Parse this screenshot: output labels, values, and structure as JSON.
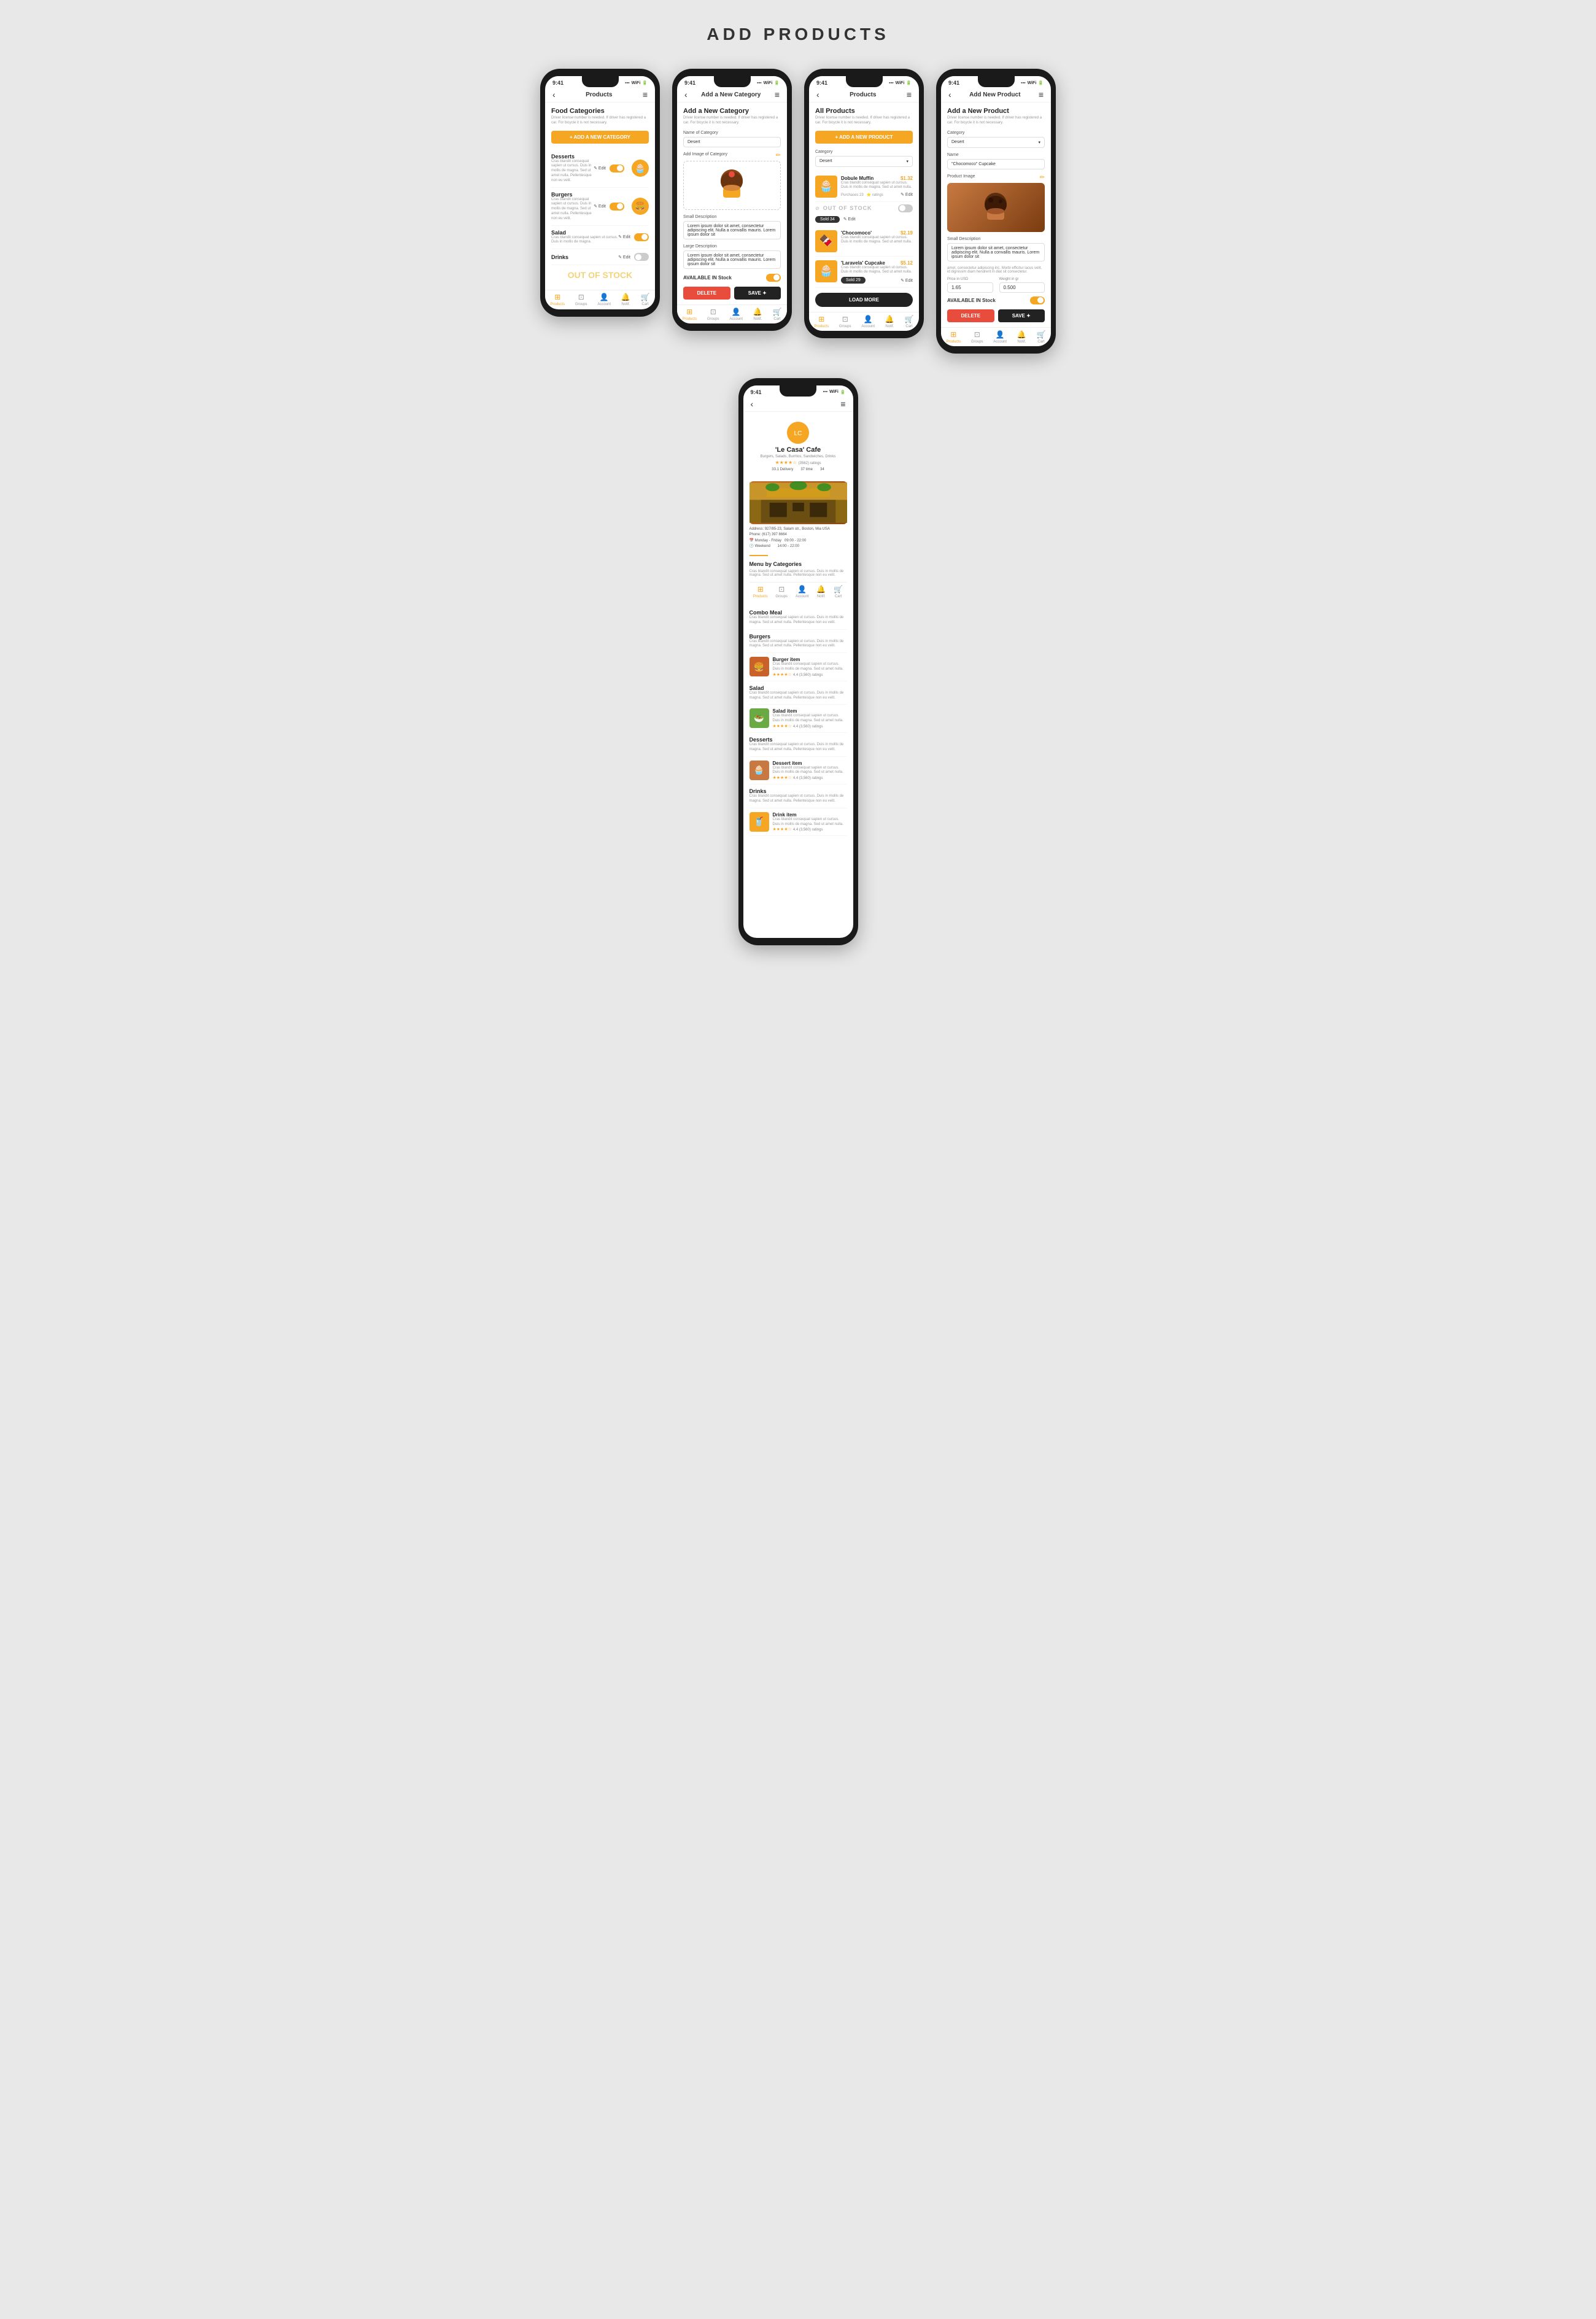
{
  "page": {
    "title": "ADD PRODUCTS"
  },
  "phone1": {
    "status_time": "9:41",
    "title": "Products",
    "screen_title": "Food Categories",
    "subtitle": "Driver license number is needed. If driver has registered a car. For bicycle it is not necessary.",
    "add_btn": "+ ADD A NEW CATEGORY",
    "categories": [
      {
        "name": "Desserts",
        "desc": "Cras blandit consequat sapien ut cursus. Duis in mollis de magna. Sed ut amet nulla. Pellentesque non eu velit.",
        "has_img": true,
        "on": true
      },
      {
        "name": "Burgers",
        "desc": "Cras blandit consequat sapien ut cursus. Duis in mollis de magna. Sed ut amet nulla. Pellentesque non eu velit.",
        "has_img": true,
        "on": true
      },
      {
        "name": "Salad",
        "desc": "Cras blandit consequat sapien ut cursus. Duis in mollis de magna.",
        "has_img": false,
        "on": true
      },
      {
        "name": "Drinks",
        "desc": "",
        "has_img": false,
        "on": false
      }
    ],
    "out_of_stock": "OUT OF STOCK",
    "bottom_nav": [
      "Products",
      "Groups",
      "Account",
      "Notifications",
      "Cart"
    ]
  },
  "phone2": {
    "status_time": "9:41",
    "title": "Add a New Category",
    "screen_title": "Add a New Category",
    "subtitle": "Driver license number is needed. If driver has registered a car. For bicycle it is not necessary.",
    "form": {
      "name_label": "Name of Category",
      "name_value": "Desert",
      "image_label": "Add Image of Category",
      "small_desc_label": "Small Description",
      "small_desc_value": "Lorem ipsum dolor sit amet, consectetur adipiscing elit. Nulla a convallis mauris. Lorem ipsum dolor sit",
      "large_desc_label": "Large Description",
      "large_desc_value": "Lorem ipsum dolor sit amet, consectetur adipiscing elit. Nulla a convallis mauris. Lorem ipsum dolor sit"
    },
    "available_stock": "AVAILABLE IN Stock",
    "delete_btn": "DELETE",
    "save_btn": "SAVE ✦",
    "bottom_nav": [
      "Products",
      "Groups",
      "Account",
      "Notifications",
      "Cart"
    ]
  },
  "phone3": {
    "status_time": "9:41",
    "title": "Products",
    "screen_title": "All Products",
    "subtitle": "Driver license number is needed. If driver has registered a car. For bicycle it is not necessary.",
    "add_btn": "+ ADD A NEW PRODUCT",
    "category_label": "Category",
    "category_value": "Desert",
    "products": [
      {
        "name": "Dobule Muffin",
        "desc": "Cras blandit consequat sapien ut cursus. Duis in mollis de magna. Sed ut amet nulla.",
        "price": "$1.32",
        "purchases": 23,
        "out_of_stock": false
      },
      {
        "name": "'Chocomoco'",
        "desc": "Cras blandit consequat sapien ut cursus. Duis in mollis de magna. Sed ut amet nulla.",
        "price": "$2.19",
        "out_of_stock": true,
        "sold": 34
      },
      {
        "name": "'Laravela' Cupcake",
        "desc": "Cras blandit consequat sapien ut cursus. Duis in mollis de magna. Sed ut amet nulla.",
        "price": "$5.12",
        "sold": 29
      }
    ],
    "out_of_stock": "OUT OF STOCK",
    "load_more": "LOAD MORE",
    "bottom_nav": [
      "Products",
      "Groups",
      "Account",
      "Notifications",
      "Cart"
    ]
  },
  "phone4": {
    "status_time": "9:41",
    "title": "Add New Product",
    "screen_title": "Add a New Product",
    "subtitle": "Driver license number is needed. If driver has registered a car. For bicycle it is not necessary.",
    "form": {
      "category_label": "Category",
      "category_value": "Desert",
      "name_label": "Name",
      "name_value": "\"Chocomoco\" Cupcake",
      "image_label": "Product Image",
      "small_desc_label": "Small Description",
      "small_desc_value": "Lorem ipsum dolor sit amet, consectetur adipiscing elit. Nulla a convallis mauris. Lorem ipsum dolor sit",
      "price_label": "Price in USD",
      "price_value": "1.65",
      "weight_label": "Weight in gr",
      "weight_value": "0.500"
    },
    "available_stock": "AVAILABLE IN Stock",
    "delete_btn": "DELETE",
    "save_btn": "SAVE ✦",
    "bottom_nav": [
      "Products",
      "Groups",
      "Account",
      "Notifications",
      "Cart"
    ]
  },
  "phone5": {
    "status_time": "9:41",
    "restaurant_name": "'Le Casa' Cafe",
    "restaurant_tags": "Burgers, Salads, Burritos, Sandwiches, Drinks",
    "rating": "4.4",
    "review_count": "(3562) ratings",
    "stats": {
      "stat1": "33.1",
      "stat1_label": "Delivery",
      "stat2": "37",
      "stat2_label": "time",
      "stat3": "34",
      "stat3_label": ""
    },
    "address": "Address: 927/85-23, Salam str., Boston, Mia USA",
    "phone": "Phone: (617) 397 8664",
    "hours": "Monday - Friday   09:00 - 22:00\nWeekend            14:00 - 22:00",
    "menu_title": "Menu by Categories",
    "menu_subtitle": "Cras blandit consequat sapien ut cursus. Duis in mollis de magna. Sed ut amet nulla. Pellentesque non eu velit.",
    "menu_categories": [
      {
        "name": "Combo Meal",
        "desc": "Cras blandit consequat sapien ut cursus. Duis in mollis de magna. Sed ut amet nulla. Pellentesque non eu velit.",
        "items": []
      },
      {
        "name": "Burgers",
        "desc": "Cras blandit consequat sapien ut cursus. Duis in mollis de magna. Sed ut amet nulla. Pellentesque non eu velit.",
        "items": [
          {
            "name": "Burger item",
            "desc": "Cras blandit consequat sapien ut cursus. Duis in mollis de magna. Sed ut amet nulla. Pellentesque non eu velit.",
            "rating": "4.4",
            "reviews": "(3,560)"
          }
        ]
      },
      {
        "name": "Salad",
        "desc": "Cras blandit consequat sapien ut cursus. Duis in mollis de magna. Sed ut amet nulla. Pellentesque non eu velit.",
        "items": [
          {
            "name": "Salad item",
            "desc": "Cras blandit consequat sapien ut cursus. Duis in mollis de magna. Sed ut amet nulla.",
            "rating": "4.4",
            "reviews": "(3,560)"
          }
        ]
      },
      {
        "name": "Desserts",
        "desc": "Cras blandit consequat sapien ut cursus. Duis in mollis de magna. Sed ut amet nulla. Pellentesque non eu velit.",
        "items": [
          {
            "name": "Dessert item",
            "desc": "Cras blandit consequat sapien ut cursus. Duis in mollis de magna. Sed ut amet nulla.",
            "rating": "4.4",
            "reviews": "(3,560)"
          }
        ]
      },
      {
        "name": "Drinks",
        "desc": "Cras blandit consequat sapien ut cursus. Duis in mollis de magna. Sed ut amet nulla. Pellentesque non eu velit.",
        "items": [
          {
            "name": "Drink item",
            "desc": "Cras blandit consequat sapien ut cursus. Duis in mollis de magna. Sed ut amet nulla.",
            "rating": "4.4",
            "reviews": "(3,560)"
          }
        ]
      }
    ],
    "bottom_nav": [
      "Products",
      "Groups",
      "Account",
      "Notifications",
      "Cart"
    ]
  }
}
